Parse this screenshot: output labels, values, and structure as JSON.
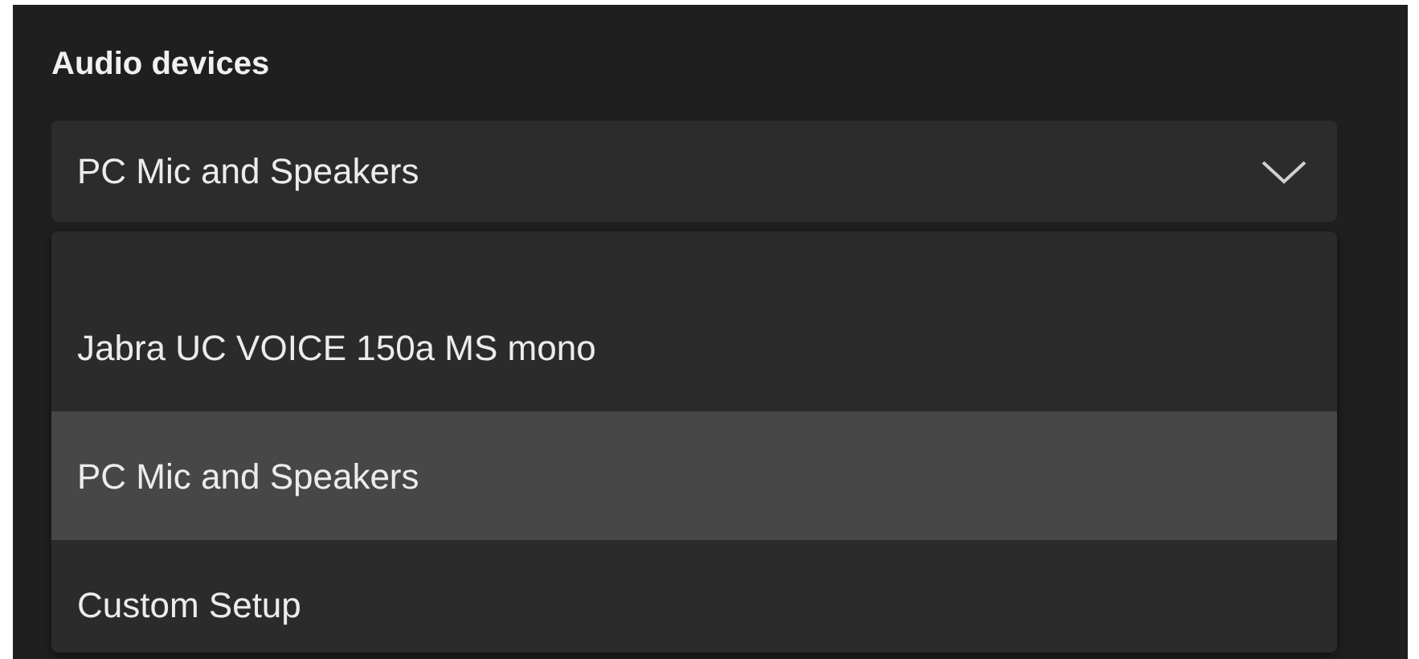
{
  "section_title": "Audio devices",
  "dropdown": {
    "value": "PC Mic and Speakers",
    "expanded": true
  },
  "options": [
    {
      "label": "Jabra UC VOICE 150a MS mono",
      "selected": false
    },
    {
      "label": "PC Mic and Speakers",
      "selected": true
    },
    {
      "label": "Custom Setup",
      "selected": false
    }
  ]
}
